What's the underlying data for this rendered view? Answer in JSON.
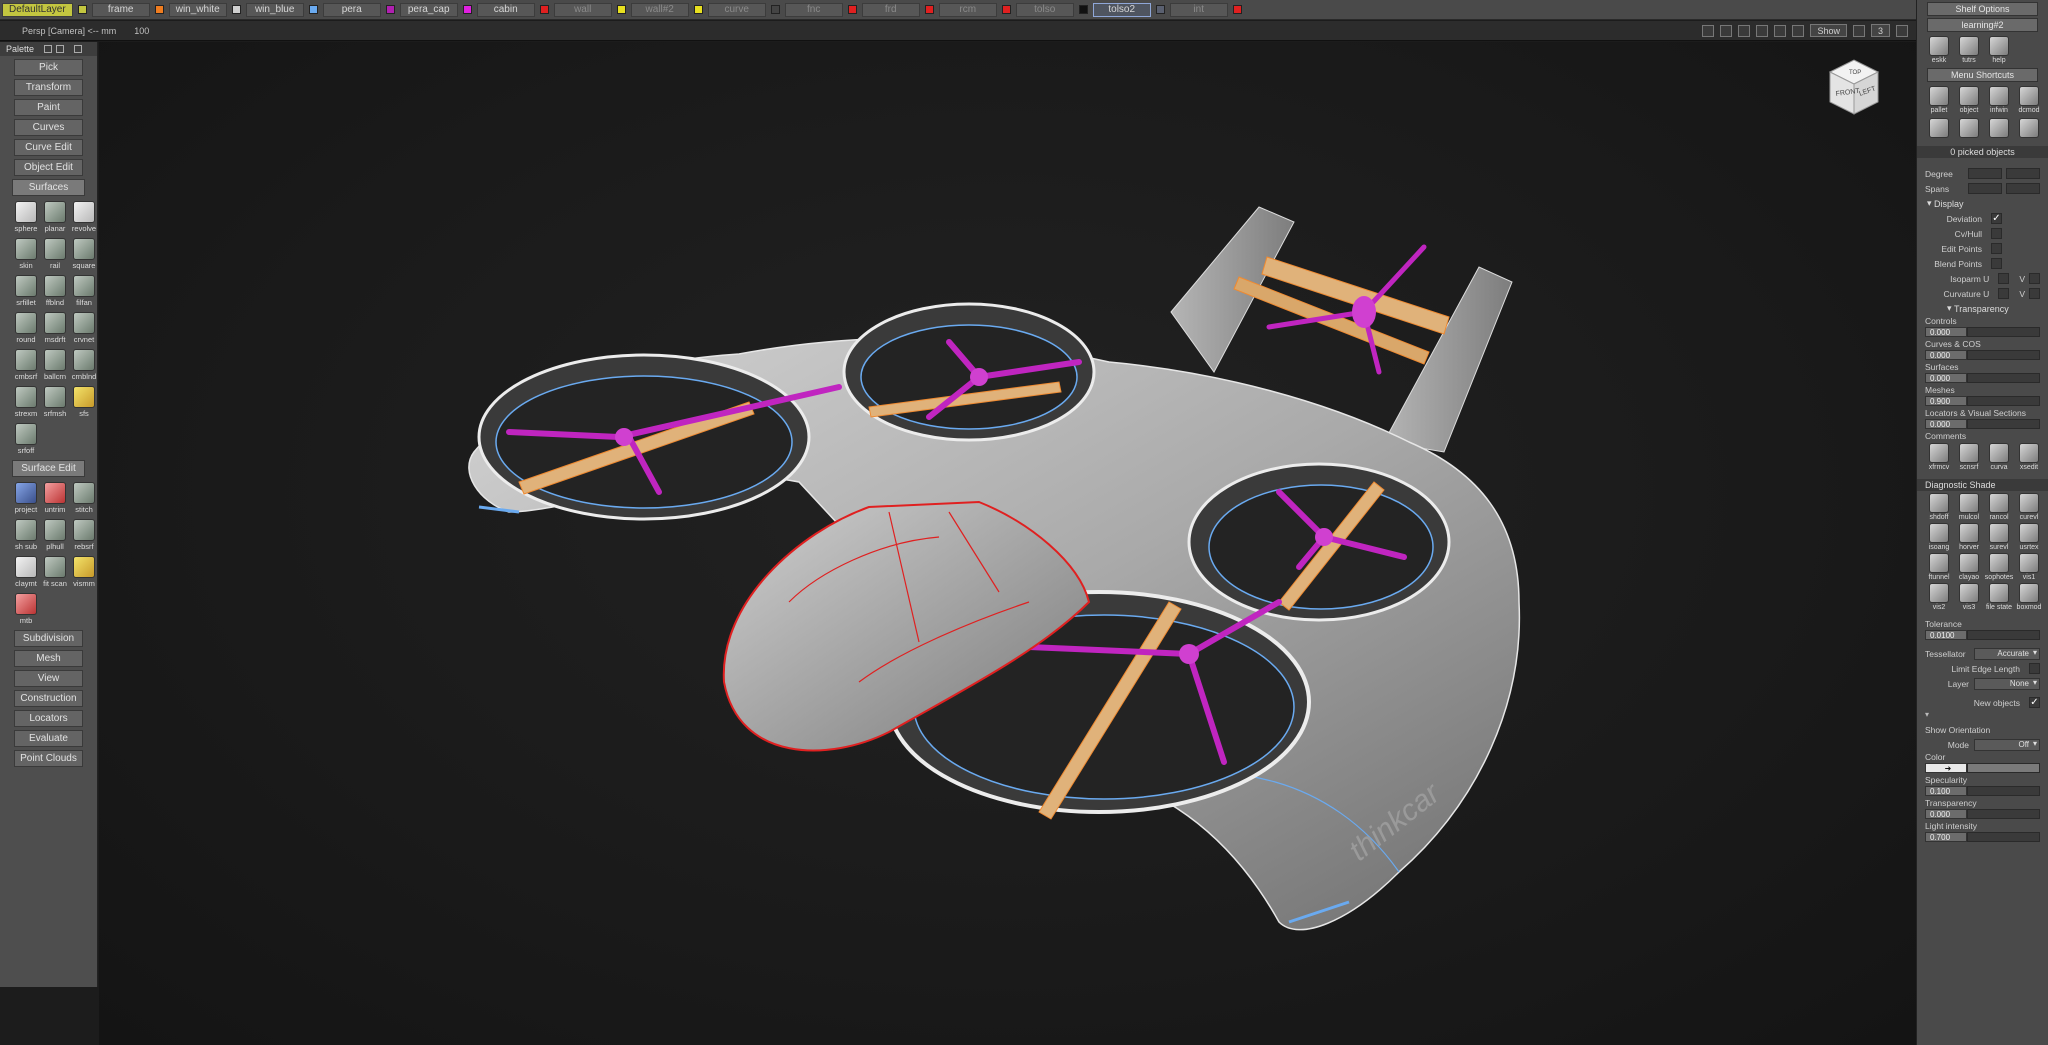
{
  "layer_bar": {
    "items": [
      {
        "label": "DefaultLayer",
        "color": "#c3c640",
        "state": "active"
      },
      {
        "label": "frame",
        "color": "#f07d20"
      },
      {
        "label": "win_white",
        "color": "#cfcfcf"
      },
      {
        "label": "win_blue",
        "color": "#6aaaf0"
      },
      {
        "label": "pera",
        "color": "#b020b0"
      },
      {
        "label": "pera_cap",
        "color": "#e020e0"
      },
      {
        "label": "cabin",
        "color": "#e02020"
      },
      {
        "label": "wall",
        "color": "#e8e020",
        "state": "dim"
      },
      {
        "label": "wall#2",
        "color": "#e8e020",
        "state": "dim"
      },
      {
        "label": "curve",
        "color": "#444444",
        "state": "dim"
      },
      {
        "label": "fnc",
        "color": "#e02020",
        "state": "dim"
      },
      {
        "label": "frd",
        "color": "#e02020",
        "state": "dim"
      },
      {
        "label": "rcm",
        "color": "#e02020",
        "state": "dim"
      },
      {
        "label": "tolso",
        "color": "#111111",
        "state": "dim"
      },
      {
        "label": "tolso2",
        "color": "#5a6070",
        "state": "hl"
      },
      {
        "label": "int",
        "color": "#e02020",
        "state": "dim"
      }
    ]
  },
  "view_header": {
    "camera": "Persp [Camera]  <-- mm",
    "zoom": "100",
    "show_label": "Show",
    "right_num": "3"
  },
  "palette": {
    "title": "Palette",
    "top_buttons": [
      "Pick",
      "Transform",
      "Paint",
      "Curves",
      "Curve Edit",
      "Object Edit"
    ],
    "surfaces_title": "Surfaces",
    "surfaces": [
      "sphere",
      "planar",
      "revolve",
      "skin",
      "rail",
      "square",
      "srfillet",
      "ffblnd",
      "filfan",
      "round",
      "msdrft",
      "crvnet",
      "cmbsrf",
      "ballcrn",
      "crnblnd",
      "strexm",
      "srfmsh",
      "sfs",
      "srfoff"
    ],
    "surface_edit_title": "Surface Edit",
    "surface_edit": [
      "project",
      "untrim",
      "stitch",
      "sh sub",
      "plhull",
      "rebsrf",
      "claymt",
      "fit scan",
      "vismm",
      "mtb"
    ],
    "bottom_buttons": [
      "Subdivision",
      "Mesh",
      "View",
      "Construction",
      "Locators",
      "Evaluate",
      "Point Clouds"
    ]
  },
  "viewcube": {
    "front": "FRONT",
    "left": "LEFT",
    "top": "TOP"
  },
  "model": {
    "brand_text": "thinkcar"
  },
  "shelf": {
    "title": "Shelf Options",
    "tab": "learning#2",
    "row1": [
      "eskk",
      "tutrs",
      "help"
    ],
    "menu_shortcuts": "Menu Shortcuts",
    "row2": [
      "pallet",
      "object",
      "infwin",
      "dcmod"
    ],
    "picked": "0 picked objects",
    "degree_label": "Degree",
    "spans_label": "Spans",
    "display_label": "Display",
    "display_opts": [
      {
        "label": "Deviation",
        "checked": "✓"
      },
      {
        "label": "Cv/Hull",
        "checked": ""
      },
      {
        "label": "Edit Points",
        "checked": ""
      },
      {
        "label": "Blend Points",
        "checked": ""
      }
    ],
    "isoparm_label": "Isoparm U",
    "curvature_label": "Curvature U",
    "v_label": "V",
    "transparency_label": "Transparency",
    "transparency": [
      {
        "label": "Controls",
        "value": "0.000"
      },
      {
        "label": "Curves & COS",
        "value": "0.000"
      },
      {
        "label": "Surfaces",
        "value": "0.000"
      },
      {
        "label": "Meshes",
        "value": "0.900"
      },
      {
        "label": "Locators & Visual Sections",
        "value": "0.000"
      }
    ],
    "cut_label": "Comments",
    "row3": [
      "xfrmcv",
      "scnsrf",
      "curva",
      "xsedit"
    ],
    "diag_title": "Diagnostic Shade",
    "diag": [
      "shdoff",
      "mulcol",
      "rancol",
      "curevl",
      "isoang",
      "horver",
      "surevl",
      "usrtex",
      "ftunnel",
      "clayao",
      "sophotes",
      "vis1",
      "vis2",
      "vis3",
      "file state",
      "boxmod"
    ],
    "tolerance_label": "Tolerance",
    "tolerance_value": "0.0100",
    "tessellator_label": "Tessellator",
    "tessellator_value": "Accurate",
    "limit_edge": "Limit Edge Length",
    "layer_label": "Layer",
    "layer_value": "None",
    "new_objects": "New objects",
    "new_objects_checked": "✓",
    "show_orient": "Show Orientation",
    "mode_label": "Mode",
    "mode_value": "Off",
    "color_label": "Color",
    "color_arrow": "➜",
    "specularity_label": "Specularity",
    "specularity_value": "0.100",
    "transp2_label": "Transparency",
    "transp2_value": "0.000",
    "light_label": "Light intensity",
    "light_value": "0.700"
  }
}
